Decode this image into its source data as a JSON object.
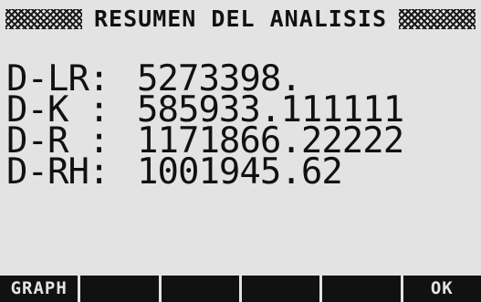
{
  "title": "RESUMEN DEL ANALISIS",
  "results": [
    {
      "label": "D-LR:",
      "value": "5273398."
    },
    {
      "label": "D-K :",
      "value": "585933.111111"
    },
    {
      "label": "D-R :",
      "value": "1171866.22222"
    },
    {
      "label": "D-RH:",
      "value": "1001945.62"
    }
  ],
  "softkeys": [
    "GRAPH",
    "",
    "",
    "",
    "",
    "OK"
  ]
}
